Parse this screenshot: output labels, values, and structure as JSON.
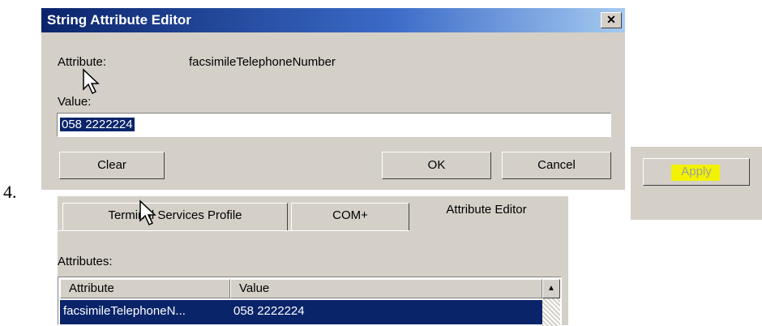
{
  "step_number": "4.",
  "dialog": {
    "title": "String Attribute Editor",
    "close_glyph": "✕",
    "attribute_label": "Attribute:",
    "attribute_value": "facsimileTelephoneNumber",
    "value_label": "Value:",
    "value_input": "058 2222224",
    "clear_label": "Clear",
    "ok_label": "OK",
    "cancel_label": "Cancel"
  },
  "apply": {
    "label": "Apply",
    "highlight_color": "#f2f200"
  },
  "properties": {
    "tabs": [
      {
        "label": "Terminal Services Profile"
      },
      {
        "label": "COM+"
      },
      {
        "label": "Attribute Editor"
      }
    ],
    "attributes_label": "Attributes:",
    "columns": [
      "Attribute",
      "Value"
    ],
    "rows": [
      {
        "attribute": "facsimileTelephoneN...",
        "value": "058 2222224"
      }
    ]
  },
  "colors": {
    "dialog_bg": "#d4d0c8",
    "selection": "#0a246a",
    "title_start": "#0a246a",
    "title_end": "#a6caf0"
  }
}
